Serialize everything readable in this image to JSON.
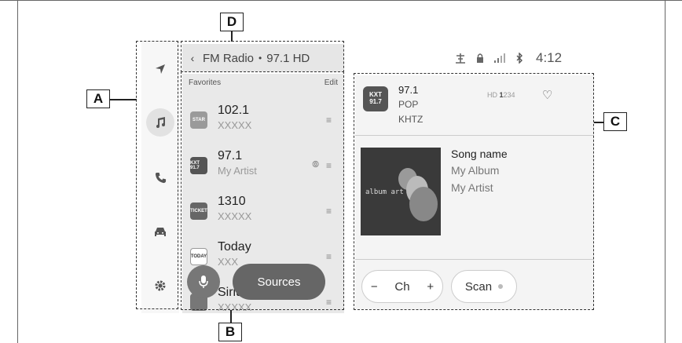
{
  "callouts": {
    "a": "A",
    "b": "B",
    "c": "C",
    "d": "D"
  },
  "sidebar": {
    "icons": [
      "navigation-icon",
      "music-icon",
      "phone-icon",
      "car-icon",
      "settings-icon"
    ],
    "active": "music-icon"
  },
  "header": {
    "back_glyph": "‹",
    "source": "FM Radio",
    "separator": "•",
    "station": "97.1 HD"
  },
  "favorites": {
    "heading": "Favorites",
    "edit_label": "Edit",
    "items": [
      {
        "title": "102.1",
        "subtitle": "XXXXX",
        "logo": "STAR"
      },
      {
        "title": "97.1",
        "subtitle": "My Artist",
        "logo": "KXT 91.7"
      },
      {
        "title": "1310",
        "subtitle": "XXXXX",
        "logo": "TICKET"
      },
      {
        "title": "Today",
        "subtitle": "XXX",
        "logo": "TODAY"
      },
      {
        "title": "Siriu",
        "subtitle": "XXXXX",
        "logo": ""
      }
    ],
    "menu_glyph": "≡",
    "broadcast_glyph": "⦾"
  },
  "controls": {
    "sources_label": "Sources"
  },
  "status": {
    "time": "4:12"
  },
  "now_playing": {
    "logo_text": "KXT 91.7",
    "frequency": "97.1",
    "genre": "POP",
    "call_sign": "KHTZ",
    "hd_prefix": "HD",
    "hd_current": "1",
    "hd_others": "234",
    "art_label": "album art",
    "song": "Song name",
    "album": "My Album",
    "artist": "My Artist",
    "ch_minus": "−",
    "ch_label": "Ch",
    "ch_plus": "+",
    "scan_label": "Scan"
  },
  "colors": {
    "accent": "#666666",
    "panel": "#e9e9e9",
    "sidebar": "#f7f7f7"
  }
}
